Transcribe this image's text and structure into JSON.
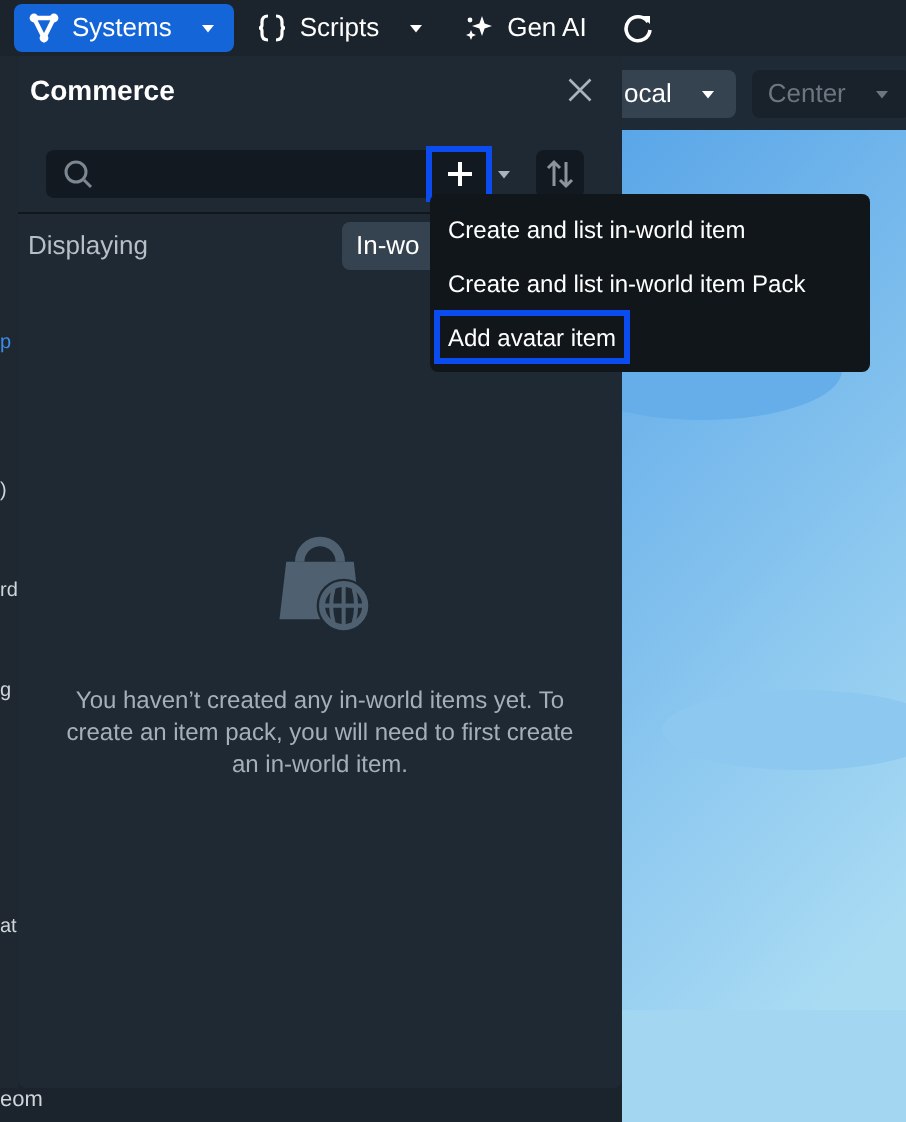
{
  "menu_bar": [
    {
      "kind": "systems",
      "label": "Systems",
      "selected": true,
      "dropdown": true
    },
    {
      "kind": "scripts",
      "label": "Scripts",
      "selected": false,
      "dropdown": true
    },
    {
      "kind": "genai",
      "label": "Gen AI",
      "selected": false,
      "dropdown": false
    },
    {
      "kind": "refresh",
      "selected": false,
      "dropdown": false
    }
  ],
  "toolbar": [
    {
      "label": "ocal",
      "disabled": false
    },
    {
      "label": "Center",
      "disabled": true
    }
  ],
  "sidebar": {
    "items": [
      {
        "label": "p",
        "link": true
      },
      {
        "label": ")",
        "link": false
      },
      {
        "label": "rd",
        "link": false
      },
      {
        "label": "g",
        "link": false
      },
      {
        "label": "at",
        "link": false
      }
    ]
  },
  "footer_text": "eom",
  "panel": {
    "title": "Commerce",
    "add_button": {
      "highlighted": true
    },
    "displaying": {
      "label": "Displaying",
      "value": "In-wo"
    },
    "empty_message": "You haven’t created any in-world items yet. To create an item pack, you will need to first create an in-world item."
  },
  "add_menu": {
    "items": [
      {
        "label": "Create and list in-world item",
        "highlighted": false
      },
      {
        "label": "Create and list in-world item Pack",
        "highlighted": false
      },
      {
        "label": "Add avatar item",
        "highlighted": true
      }
    ]
  }
}
